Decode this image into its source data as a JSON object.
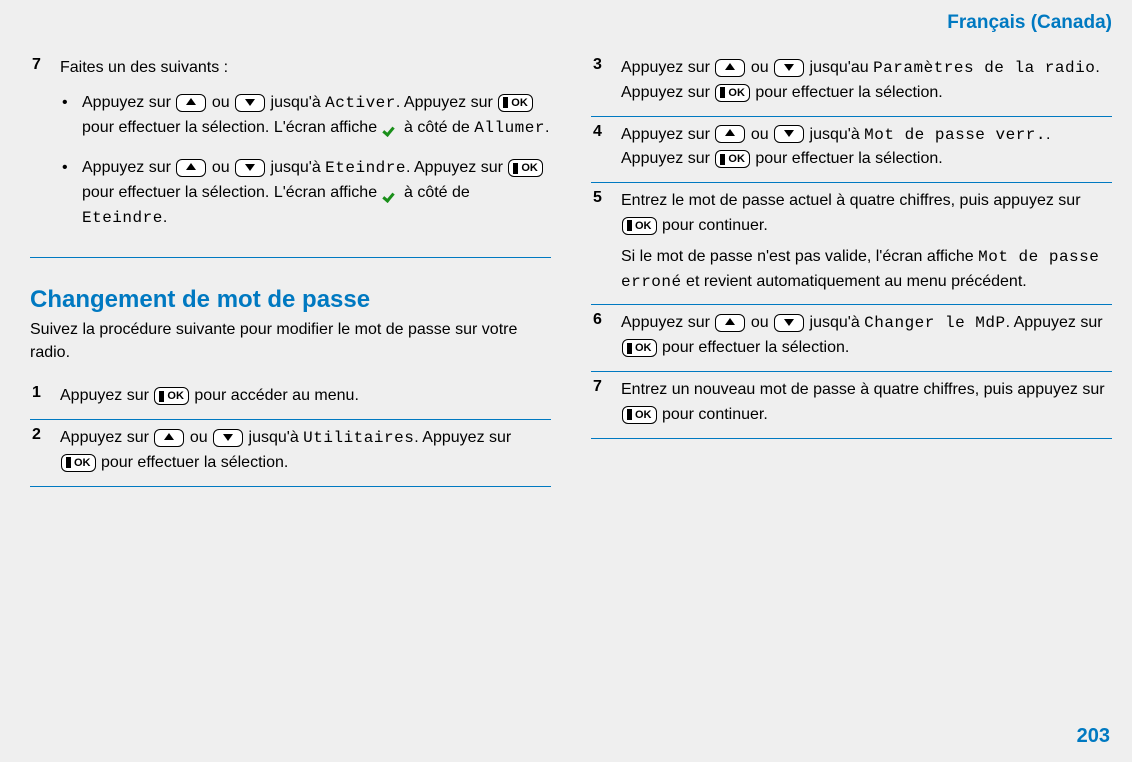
{
  "header": {
    "language": "Français (Canada)"
  },
  "page_number": "203",
  "icons": {
    "ok_text": "OK"
  },
  "left": {
    "step7": {
      "n": "7",
      "intro": "Faites un des suivants :",
      "b1": {
        "t1": "Appuyez sur ",
        "t2": " ou ",
        "t3": " jusqu'à ",
        "code1": "Activer",
        "t4": ". Appuyez sur ",
        "t5": " pour effectuer la sélection. L'écran affiche ",
        "t6": " à côté de ",
        "code2": "Allumer",
        "t7": "."
      },
      "b2": {
        "t1": "Appuyez sur ",
        "t2": " ou ",
        "t3": " jusqu'à ",
        "code1": "Eteindre",
        "t4": ". Appuyez sur ",
        "t5": " pour effectuer la sélection. L'écran affiche ",
        "t6": " à côté de ",
        "code2": "Eteindre",
        "t7": "."
      }
    },
    "section_title": "Changement de mot de passe",
    "section_intro": "Suivez la procédure suivante pour modifier le mot de passe sur votre radio.",
    "step1": {
      "n": "1",
      "t1": "Appuyez sur ",
      "t2": " pour accéder au menu."
    },
    "step2": {
      "n": "2",
      "t1": "Appuyez sur ",
      "t2": " ou ",
      "t3": " jusqu'à ",
      "code1": "Utilitaires",
      "t4": ". Appuyez sur ",
      "t5": " pour effectuer la sélection."
    }
  },
  "right": {
    "step3": {
      "n": "3",
      "t1": "Appuyez sur ",
      "t2": " ou ",
      "t3": " jusqu'au ",
      "code1": "Paramètres de la radio",
      "t4": ". Appuyez sur ",
      "t5": " pour effectuer la sélection."
    },
    "step4": {
      "n": "4",
      "t1": "Appuyez sur ",
      "t2": " ou ",
      "t3": " jusqu'à ",
      "code1": "Mot de passe verr.",
      "t4": ". Appuyez sur ",
      "t5": " pour effectuer la sélection."
    },
    "step5": {
      "n": "5",
      "t1": "Entrez le mot de passe actuel à quatre chiffres, puis appuyez sur ",
      "t2": " pour continuer.",
      "t3": "Si le mot de passe n'est pas valide, l'écran affiche ",
      "code1": "Mot de passe erroné",
      "t4": " et revient automatiquement au menu précédent."
    },
    "step6": {
      "n": "6",
      "t1": "Appuyez sur ",
      "t2": " ou ",
      "t3": " jusqu'à ",
      "code1": "Changer le MdP",
      "t4": ". Appuyez sur ",
      "t5": " pour effectuer la sélection."
    },
    "step7b": {
      "n": "7",
      "t1": "Entrez un nouveau mot de passe à quatre chiffres, puis appuyez sur ",
      "t2": " pour continuer."
    }
  }
}
